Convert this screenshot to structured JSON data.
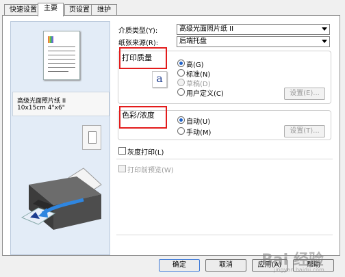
{
  "tabs": [
    {
      "label": "快速设置"
    },
    {
      "label": "主要"
    },
    {
      "label": "页设置"
    },
    {
      "label": "维护"
    }
  ],
  "preview": {
    "paper_name": "高级光面照片纸 II",
    "paper_size": "10x15cm 4\"x6\""
  },
  "media_type": {
    "label": "介质类型(Y):",
    "value": "高级光面照片纸 II"
  },
  "paper_source": {
    "label": "纸张来源(R):",
    "value": "后端托盘"
  },
  "print_quality": {
    "title": "打印质量",
    "options": [
      "高(G)",
      "标准(N)",
      "草稿(D)",
      "用户定义(C)"
    ],
    "selected": "高(G)",
    "settings_button": "设置(E)..."
  },
  "color_intensity": {
    "title": "色彩/浓度",
    "options": [
      "自动(U)",
      "手动(M)"
    ],
    "selected": "自动(U)",
    "settings_button": "设置(T)..."
  },
  "grayscale": {
    "label": "灰度打印(L)",
    "checked": false
  },
  "print_preview": {
    "label": "打印前预览(W)",
    "checked": false
  },
  "footer": {
    "ok": "确定",
    "cancel": "取消",
    "apply": "应用(A)",
    "help": "帮助"
  },
  "watermark": {
    "text": "Bai 经验",
    "sub": "jingyan.baidu.com"
  },
  "colors": {
    "highlight": "#e31b1b",
    "accent": "#2062c8"
  }
}
